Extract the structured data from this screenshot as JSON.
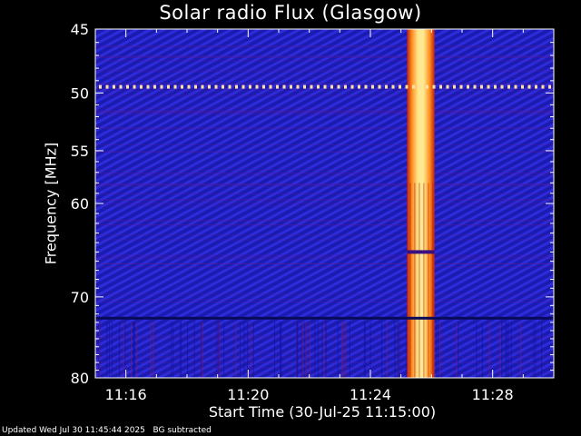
{
  "chart_data": {
    "type": "heatmap",
    "title": "Solar radio Flux (Glasgow)",
    "xlabel": "Start Time (30-Jul-25 11:15:00)",
    "ylabel": "Frequency [MHz]",
    "x_ticks": [
      "11:16",
      "11:20",
      "11:24",
      "11:28"
    ],
    "x_tick_minutes": [
      1,
      5,
      9,
      13
    ],
    "x_range_minutes": [
      0,
      15
    ],
    "y_ticks": [
      45,
      50,
      55,
      60,
      70,
      80
    ],
    "y_range_mhz": [
      45,
      80
    ],
    "y_scale": "log",
    "colormap": [
      "#10106a",
      "#2a2ad0",
      "#7a1060",
      "#d03010",
      "#ffd040",
      "#ffffff"
    ],
    "features": [
      {
        "kind": "burst",
        "time_minutes": [
          10.2,
          11.1
        ],
        "freq_mhz": [
          45,
          80
        ]
      },
      {
        "kind": "interference",
        "freq_mhz": 49.5
      },
      {
        "kind": "interference",
        "freq_mhz": 72.5
      }
    ],
    "footer": {
      "updated": "Updated Wed Jul 30 11:45:44 2025",
      "note": "BG subtracted"
    }
  }
}
